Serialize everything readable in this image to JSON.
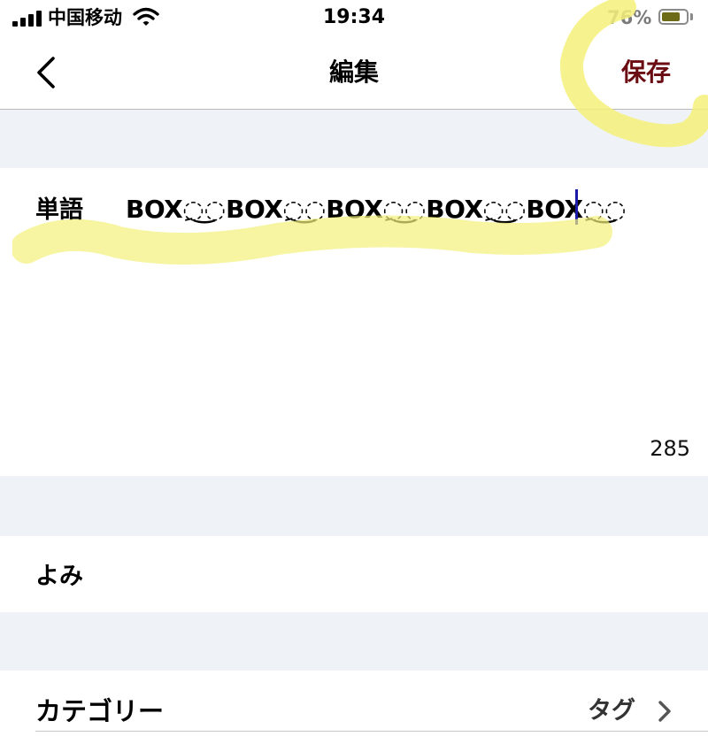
{
  "status_bar": {
    "carrier": "中国移动",
    "time": "19:34",
    "battery_percent": "76%",
    "battery_level": 0.76,
    "signal_icon": "signal-bars-icon",
    "wifi_icon": "wifi-icon",
    "battery_icon": "battery-icon"
  },
  "nav": {
    "title": "編集",
    "save_label": "保存",
    "back_icon": "chevron-left-icon"
  },
  "form": {
    "word_label": "単語",
    "word_value": "BOX◌ِ◌͜BOX◌ِ◌͜BOX◌ِ◌͜BOX◌ِ◌͜BOX◌ِ◌͜",
    "char_count": "285",
    "reading_label": "よみ",
    "category_label": "カテゴリー",
    "category_value": "タグ",
    "category_chevron_icon": "chevron-right-icon"
  },
  "colors": {
    "save_text": "#6b0c12",
    "highlighter": "#f4f17a",
    "section_gap": "#eff2f6",
    "caret": "#1a1aa6"
  }
}
